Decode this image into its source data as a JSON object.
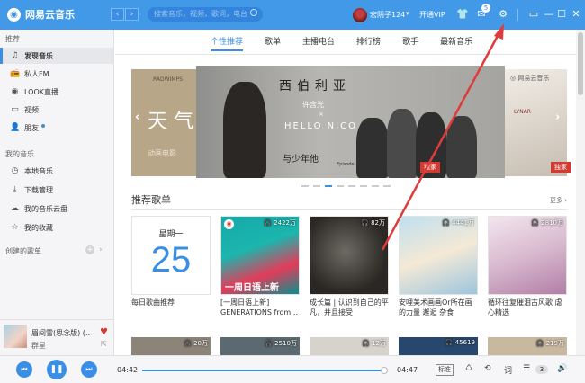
{
  "app": {
    "name": "网易云音乐",
    "logo_glyph": "◉"
  },
  "titlebar": {
    "back_icon": "‹",
    "forward_icon": "›",
    "search_placeholder": "搜索音乐，视频，歌词，电台",
    "username": "宏阴子124",
    "caret": "▾",
    "vip_label": "开通VIP",
    "mail_badge": "5",
    "icons": {
      "skin": "shirt-icon",
      "mail": "mail-icon",
      "settings": "gear-icon",
      "mini": "mini-mode-icon",
      "minimize": "minimize-icon",
      "maximize": "maximize-icon",
      "close": "close-icon"
    },
    "glyphs": {
      "skin": "👕",
      "mail": "✉",
      "settings": "⚙",
      "mini": "▭",
      "minimize": "—",
      "maximize": "☐",
      "close": "✕"
    }
  },
  "sidebar": {
    "recommend_header": "推荐",
    "recommend": [
      {
        "label": "发现音乐",
        "icon": "♫",
        "active": true
      },
      {
        "label": "私人FM",
        "icon": "📻"
      },
      {
        "label": "LOOK直播",
        "icon": "◉"
      },
      {
        "label": "视频",
        "icon": "▭"
      },
      {
        "label": "朋友",
        "icon": "👤"
      }
    ],
    "mymusic_header": "我的音乐",
    "mymusic": [
      {
        "label": "本地音乐",
        "icon": "◷"
      },
      {
        "label": "下载管理",
        "icon": "⤓"
      },
      {
        "label": "我的音乐云盘",
        "icon": "☁"
      },
      {
        "label": "我的收藏",
        "icon": "☆"
      }
    ],
    "created_header": "创建的歌单",
    "plus": "+",
    "chev": "›"
  },
  "now_playing": {
    "title": "眉间雪(思念版) (…",
    "artist": "群星",
    "heart": "♥",
    "share": "⇱"
  },
  "tabs": [
    "个性推荐",
    "歌单",
    "主播电台",
    "排行榜",
    "歌手",
    "最新音乐"
  ],
  "banner": {
    "left_top": "RADWIMPS",
    "left_text": "天 气",
    "left_sub": "动画电影",
    "main_title": "西伯利亚",
    "main_artist": "许含光",
    "main_x": "×",
    "main_sub": "HELLO NICO",
    "main_script": "与少年他",
    "main_ep": "Episode 单曲 · 预览",
    "right_logo": "◎ 网易云音乐",
    "right_text": "LYNAR",
    "tag1": "独家",
    "tag2": "独家",
    "arrow_left": "‹",
    "arrow_right": "›",
    "dot_count": 8,
    "active_dot": 2
  },
  "section": {
    "title": "推荐歌单",
    "more": "更多 ›"
  },
  "cards": [
    {
      "caption": "每日歌曲推荐",
      "day": "星期一",
      "date": "25"
    },
    {
      "caption": "[一周日语上新] GENERATIONS from…",
      "plays": "🎧 2422万",
      "art_text": "一周日语上新"
    },
    {
      "caption": "成长篇 | 认识到自己的平凡，并且接受",
      "plays": "🎧 82万"
    },
    {
      "caption": "安哩美术画画Or所在画的力量 邂逅 杂食",
      "plays": "🎧 4441万"
    },
    {
      "caption": "循环往复催泪古风歌 虐心精选",
      "plays": "🎧 2810万"
    }
  ],
  "row2_plays": [
    "🎧 20万",
    "🎧 2510万",
    "🎧 12万",
    "🎧 45619",
    "🎧 219万"
  ],
  "player": {
    "prev": "⏮",
    "play": "❚❚",
    "next": "⏭",
    "current": "04:42",
    "total": "04:47",
    "progress_fraction": 0.99,
    "quality": "标准",
    "mode": "♺",
    "loop": "⟲",
    "lyric": "词",
    "list": "☰",
    "queue_count": "3",
    "volume": "🔊"
  },
  "colors": {
    "accent": "#3a8ee6",
    "titlebar": "#4199e8",
    "red": "#d33a31",
    "arrow": "#e03b3b"
  }
}
